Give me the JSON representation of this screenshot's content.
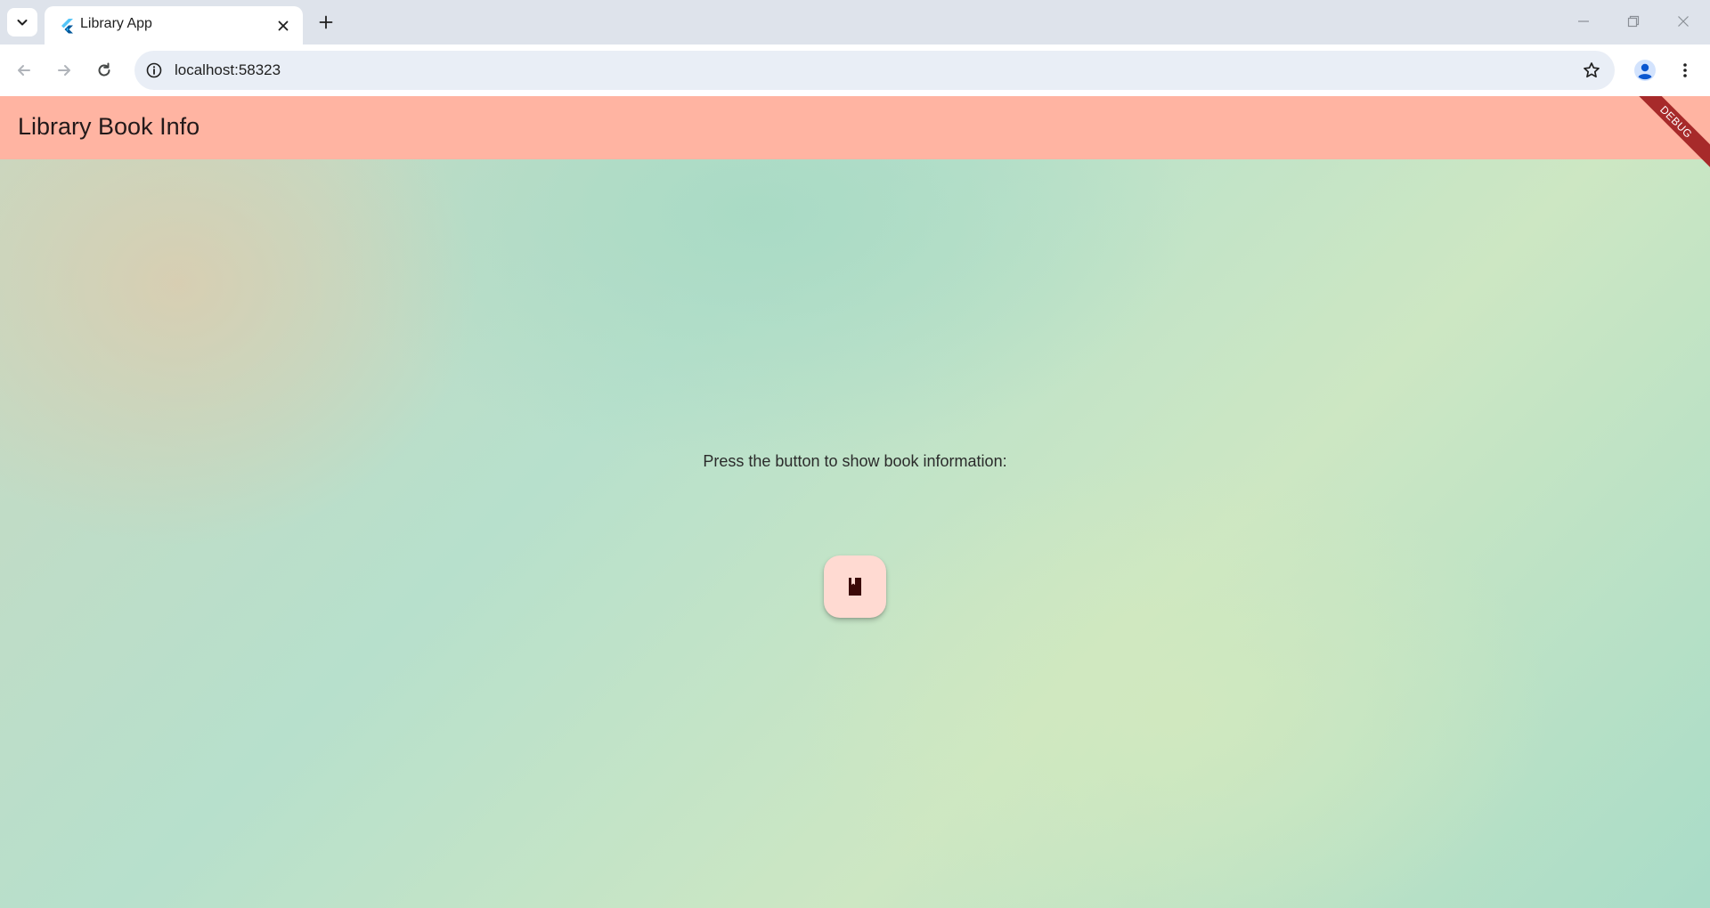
{
  "browser": {
    "tab_title": "Library App",
    "url": "localhost:58323"
  },
  "app": {
    "title": "Library Book Info",
    "debug_label": "DEBUG",
    "prompt": "Press the button to show book information:",
    "fab_icon": "book-icon"
  },
  "colors": {
    "appbar": "#ffb4a2",
    "fab": "#ffdad2",
    "debug_banner": "#a72a2a"
  }
}
